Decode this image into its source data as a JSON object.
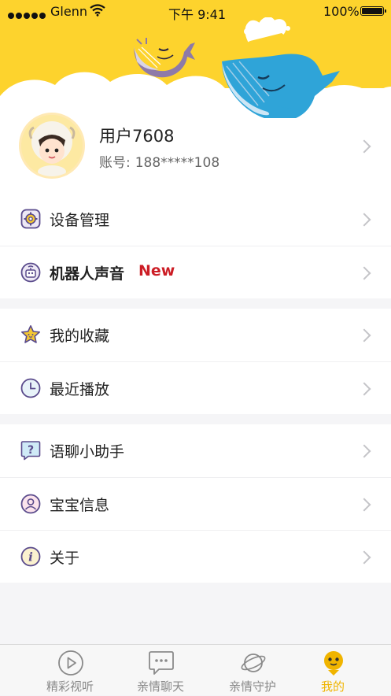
{
  "status_bar": {
    "carrier": "Glenn",
    "time": "下午 9:41",
    "battery": "100%"
  },
  "profile": {
    "username": "用户7608",
    "account_label": "账号:",
    "account_value": "188*****108"
  },
  "groups": [
    {
      "items": [
        {
          "label": "设备管理",
          "icon": "gear-icon"
        },
        {
          "label": "机器人声音",
          "badge": "New",
          "icon": "robot-icon"
        }
      ]
    },
    {
      "items": [
        {
          "label": "我的收藏",
          "icon": "star-icon"
        },
        {
          "label": "最近播放",
          "icon": "clock-icon"
        }
      ]
    },
    {
      "items": [
        {
          "label": "语聊小助手",
          "icon": "question-icon"
        },
        {
          "label": "宝宝信息",
          "icon": "person-icon"
        },
        {
          "label": "关于",
          "icon": "info-icon"
        }
      ]
    }
  ],
  "tabs": [
    {
      "label": "精彩视听",
      "icon": "play-icon"
    },
    {
      "label": "亲情聊天",
      "icon": "chat-icon"
    },
    {
      "label": "亲情守护",
      "icon": "planet-icon"
    },
    {
      "label": "我的",
      "icon": "profile-face-icon",
      "active": true
    }
  ],
  "colors": {
    "header": "#fdd32d",
    "accent_tab": "#f0b400",
    "badge_new": "#cc1d25",
    "icon_purple": "#5a4b8c"
  }
}
